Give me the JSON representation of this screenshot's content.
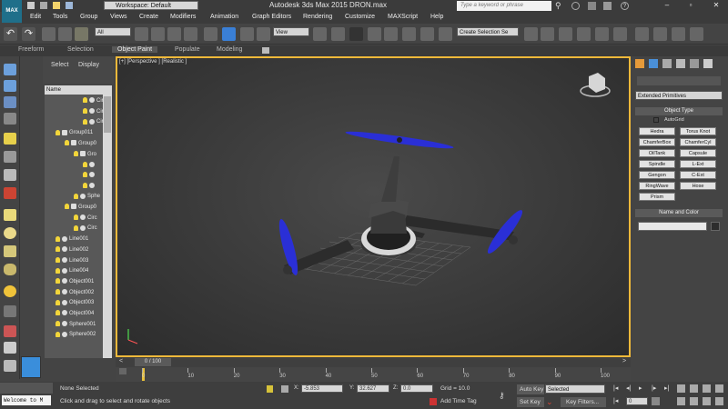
{
  "app": {
    "logo": "MAX",
    "title": "Autodesk 3ds Max  2015    DRON.max",
    "workspace": "Workspace: Default",
    "search_placeholder": "Type a keyword or phrase"
  },
  "menu": [
    "Edit",
    "Tools",
    "Group",
    "Views",
    "Create",
    "Modifiers",
    "Animation",
    "Graph Editors",
    "Rendering",
    "Customize",
    "MAXScript",
    "Help"
  ],
  "toolbar": {
    "filter": "All",
    "refcoord": "View",
    "selection_set": "Create Selection Se"
  },
  "ribbon": {
    "tabs": [
      "Freeform",
      "Selection",
      "Object Paint",
      "Populate",
      "Modeling"
    ],
    "active": "Object Paint"
  },
  "scene_explorer": {
    "tabs": [
      "Select",
      "Display"
    ],
    "column": "Name",
    "rows": [
      {
        "label": "Circ",
        "indent": 3,
        "icon": "cir"
      },
      {
        "label": "Circ",
        "indent": 3,
        "icon": "cir"
      },
      {
        "label": "Circ",
        "indent": 3,
        "icon": "cir"
      },
      {
        "label": "Group011",
        "indent": 0,
        "icon": "grp"
      },
      {
        "label": "Group0",
        "indent": 1,
        "icon": "grp"
      },
      {
        "label": "Gro",
        "indent": 2,
        "icon": "grp"
      },
      {
        "label": "",
        "indent": 3,
        "icon": "cir"
      },
      {
        "label": "",
        "indent": 3,
        "icon": "cir"
      },
      {
        "label": "",
        "indent": 3,
        "icon": "obj"
      },
      {
        "label": "Sphe",
        "indent": 2,
        "icon": "obj"
      },
      {
        "label": "Group0",
        "indent": 1,
        "icon": "grp"
      },
      {
        "label": "Circ",
        "indent": 2,
        "icon": "cir"
      },
      {
        "label": "Circ",
        "indent": 2,
        "icon": "cir"
      },
      {
        "label": "Line001",
        "indent": 0,
        "icon": "cir"
      },
      {
        "label": "Line002",
        "indent": 0,
        "icon": "cir"
      },
      {
        "label": "Line003",
        "indent": 0,
        "icon": "cir"
      },
      {
        "label": "Line004",
        "indent": 0,
        "icon": "cir"
      },
      {
        "label": "Object001",
        "indent": 0,
        "icon": "obj"
      },
      {
        "label": "Object002",
        "indent": 0,
        "icon": "obj"
      },
      {
        "label": "Object003",
        "indent": 0,
        "icon": "obj"
      },
      {
        "label": "Object004",
        "indent": 0,
        "icon": "obj"
      },
      {
        "label": "Sphere001",
        "indent": 0,
        "icon": "obj"
      },
      {
        "label": "Sphere002",
        "indent": 0,
        "icon": "obj"
      }
    ]
  },
  "viewport": {
    "label": "[+] [Perspective ] [Realistic ]"
  },
  "command_panel": {
    "dropdown": "Extended Primitives",
    "object_type_title": "Object Type",
    "autogrid": "AutoGrid",
    "buttons": [
      "Hedra",
      "Torus Knot",
      "ChamferBox",
      "ChamferCyl",
      "OilTank",
      "Capsule",
      "Spindle",
      "L-Ext",
      "Gengon",
      "C-Ext",
      "RingWave",
      "Hose",
      "Prism"
    ],
    "name_color_title": "Name and Color",
    "color": "#2d2d2d"
  },
  "timeline": {
    "frame": "0 / 100",
    "ticks": [
      "0",
      "10",
      "20",
      "30",
      "40",
      "50",
      "60",
      "70",
      "80",
      "90",
      "100"
    ]
  },
  "status": {
    "listener": "Welcome to M",
    "selection": "None Selected",
    "prompt": "Click and drag to select and rotate objects",
    "x_label": "X:",
    "x": "-5.853",
    "y_label": "Y:",
    "y": "32.627",
    "z_label": "Z:",
    "z": "0.0",
    "grid": "Grid = 10.0",
    "add_time_tag": "Add Time Tag",
    "autokey": "Auto Key",
    "setkey": "Set Key",
    "selected": "Selected",
    "keyfilters": "Key Filters...",
    "frame_field": "0"
  },
  "colors": {
    "viewport_border": "#f0b93a",
    "autokey_bg": "#5a5a5a",
    "rotor": "#2a2fd6"
  }
}
